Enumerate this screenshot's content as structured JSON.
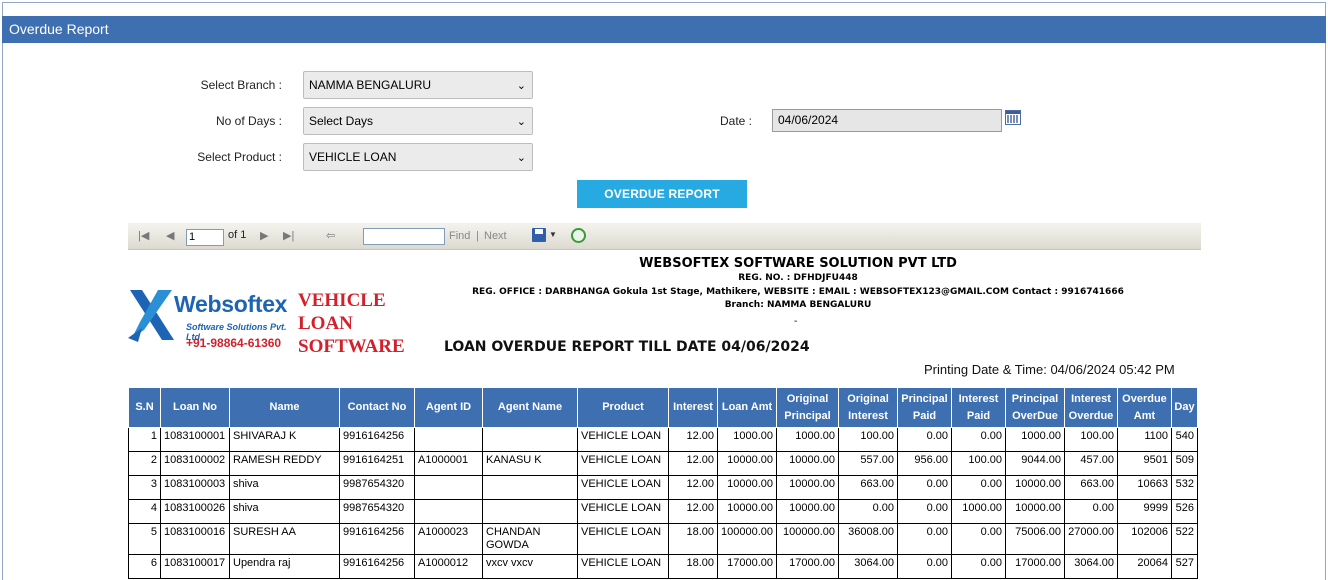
{
  "page_title": "Overdue Report",
  "filters": {
    "branch_label": "Select Branch :",
    "branch_value": "NAMMA BENGALURU",
    "days_label": "No of Days :",
    "days_value": "Select Days",
    "product_label": "Select Product :",
    "product_value": "VEHICLE LOAN",
    "date_label": "Date :",
    "date_value": "04/06/2024"
  },
  "report_button": "OVERDUE REPORT",
  "toolbar": {
    "page_current": "1",
    "page_of": "of 1",
    "find": "Find",
    "separator": "|",
    "next": "Next"
  },
  "company": {
    "name": "WEBSOFTEX SOFTWARE SOLUTION PVT LTD",
    "reg_no": "REG. NO. : DFHDJFU448",
    "office": "REG. OFFICE : DARBHANGA  Gokula 1st Stage, Mathikere, WEBSITE :     EMAIL : WEBSOFTEX123@GMAIL.COM        Contact : 9916741666",
    "branch": "Branch: NAMMA BENGALURU",
    "dash": "-"
  },
  "logo": {
    "brand": "Websoftex",
    "sub": "Software Solutions Pvt. Ltd.",
    "phone": "+91-98864-61360",
    "product_line1": "VEHICLE",
    "product_line2": "LOAN",
    "product_line3": "SOFTWARE"
  },
  "report_title": "LOAN OVERDUE REPORT TILL DATE 04/06/2024",
  "printing_date": "Printing Date & Time:  04/06/2024 05:42 PM",
  "colors": {
    "header_blue": "#3e6fb0",
    "button_blue": "#27aae1",
    "brand_red": "#d4202a"
  },
  "table": {
    "headers": [
      "S.N",
      "Loan No",
      "Name",
      "Contact No",
      "Agent ID",
      "Agent Name",
      "Product",
      "Interest",
      "Loan Amt",
      "Original Principal",
      "Original Interest",
      "Principal Paid",
      "Interest Paid",
      "Principal OverDue",
      "Interest Overdue",
      "Overdue Amt",
      "Day"
    ],
    "rows": [
      [
        "1",
        "1083100001",
        "SHIVARAJ K",
        "9916164256",
        "",
        "",
        "VEHICLE LOAN",
        "12.00",
        "1000.00",
        "1000.00",
        "100.00",
        "0.00",
        "0.00",
        "1000.00",
        "100.00",
        "1100",
        "540"
      ],
      [
        "2",
        "1083100002",
        "RAMESH  REDDY",
        "9916164251",
        "A1000001",
        "KANASU K",
        "VEHICLE LOAN",
        "12.00",
        "10000.00",
        "10000.00",
        "557.00",
        "956.00",
        "100.00",
        "9044.00",
        "457.00",
        "9501",
        "509"
      ],
      [
        "3",
        "1083100003",
        "shiva",
        "9987654320",
        "",
        "",
        "VEHICLE LOAN",
        "12.00",
        "10000.00",
        "10000.00",
        "663.00",
        "0.00",
        "0.00",
        "10000.00",
        "663.00",
        "10663",
        "532"
      ],
      [
        "4",
        "1083100026",
        "shiva",
        "9987654320",
        "",
        "",
        "VEHICLE LOAN",
        "12.00",
        "10000.00",
        "10000.00",
        "0.00",
        "0.00",
        "1000.00",
        "10000.00",
        "0.00",
        "9999",
        "526"
      ],
      [
        "5",
        "1083100016",
        "SURESH AA",
        "9916164256",
        "A1000023",
        "CHANDAN GOWDA",
        "VEHICLE LOAN",
        "18.00",
        "100000.00",
        "100000.00",
        "36008.00",
        "0.00",
        "0.00",
        "75006.00",
        "27000.00",
        "102006",
        "522"
      ],
      [
        "6",
        "1083100017",
        "Upendra raj",
        "9916164256",
        "A1000012",
        "vxcv vxcv",
        "VEHICLE LOAN",
        "18.00",
        "17000.00",
        "17000.00",
        "3064.00",
        "0.00",
        "0.00",
        "17000.00",
        "3064.00",
        "20064",
        "527"
      ]
    ]
  }
}
